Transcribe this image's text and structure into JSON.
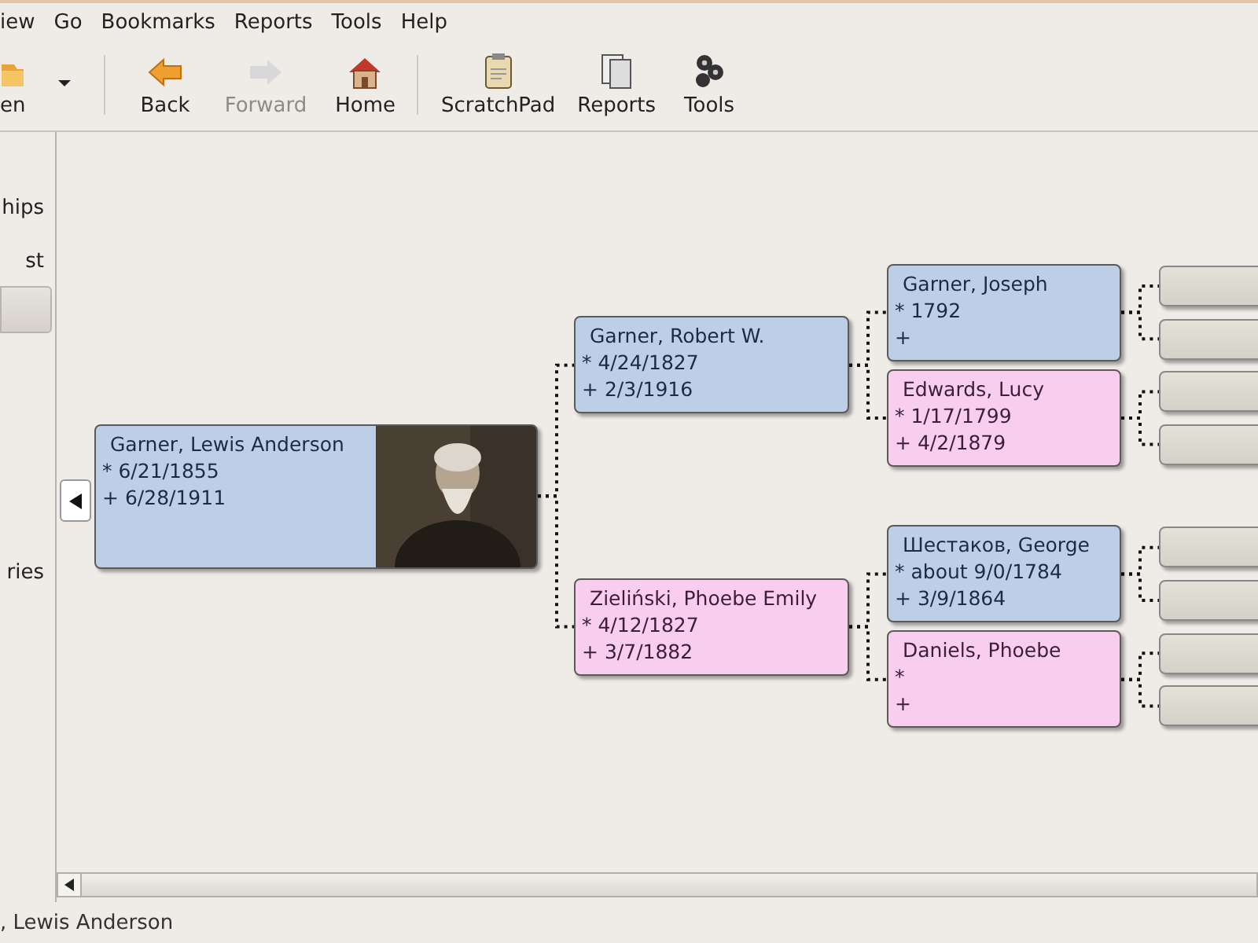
{
  "menu": [
    {
      "label": "iew"
    },
    {
      "label": "Go"
    },
    {
      "label": "Bookmarks"
    },
    {
      "label": "Reports"
    },
    {
      "label": "Tools"
    },
    {
      "label": "Help"
    }
  ],
  "toolbar": [
    {
      "kind": "open",
      "label": "en",
      "disabled": false
    },
    {
      "kind": "separator"
    },
    {
      "kind": "back",
      "label": "Back",
      "disabled": false
    },
    {
      "kind": "forward",
      "label": "Forward",
      "disabled": true
    },
    {
      "kind": "home",
      "label": "Home",
      "disabled": false
    },
    {
      "kind": "separator"
    },
    {
      "kind": "scratchpad",
      "label": "ScratchPad",
      "disabled": false
    },
    {
      "kind": "reports",
      "label": "Reports",
      "disabled": false
    },
    {
      "kind": "tools",
      "label": "Tools",
      "disabled": false
    }
  ],
  "sidebar": {
    "items": [
      {
        "label": "hips",
        "selected": false
      },
      {
        "label": "st",
        "selected": false
      },
      {
        "selected": true
      },
      {
        "label": "ries",
        "selected": false
      }
    ]
  },
  "pedigree": {
    "name": "Garner, Lewis Anderson",
    "birth": "* 6/21/1855",
    "death": "+ 6/28/1911",
    "kind": "male",
    "children": [
      {
        "name": "Garner, Robert W.",
        "birth": "* 4/24/1827",
        "death": "+ 2/3/1916",
        "kind": "male",
        "children": [
          {
            "name": "Garner, Joseph",
            "birth": "* 1792",
            "death": "+",
            "kind": "male",
            "children": [
              {
                "kind": "empty"
              },
              {
                "kind": "empty"
              }
            ]
          },
          {
            "name": "Edwards, Lucy",
            "birth": "* 1/17/1799",
            "death": "+ 4/2/1879",
            "kind": "female",
            "children": [
              {
                "kind": "empty"
              },
              {
                "kind": "empty"
              }
            ]
          }
        ]
      },
      {
        "name": "Zieliński, Phoebe Emily",
        "birth": "* 4/12/1827",
        "death": "+ 3/7/1882",
        "kind": "female",
        "children": [
          {
            "name": "Шестаков, George",
            "birth": "* about 9/0/1784",
            "death": "+ 3/9/1864",
            "kind": "male",
            "children": [
              {
                "kind": "empty"
              },
              {
                "kind": "empty"
              }
            ]
          },
          {
            "name": "Daniels, Phoebe",
            "birth": "*",
            "death": "+",
            "kind": "female",
            "children": [
              {
                "kind": "empty"
              },
              {
                "kind": "empty"
              }
            ]
          }
        ]
      }
    ]
  },
  "status_bar": {
    "text": ", Lewis Anderson"
  }
}
